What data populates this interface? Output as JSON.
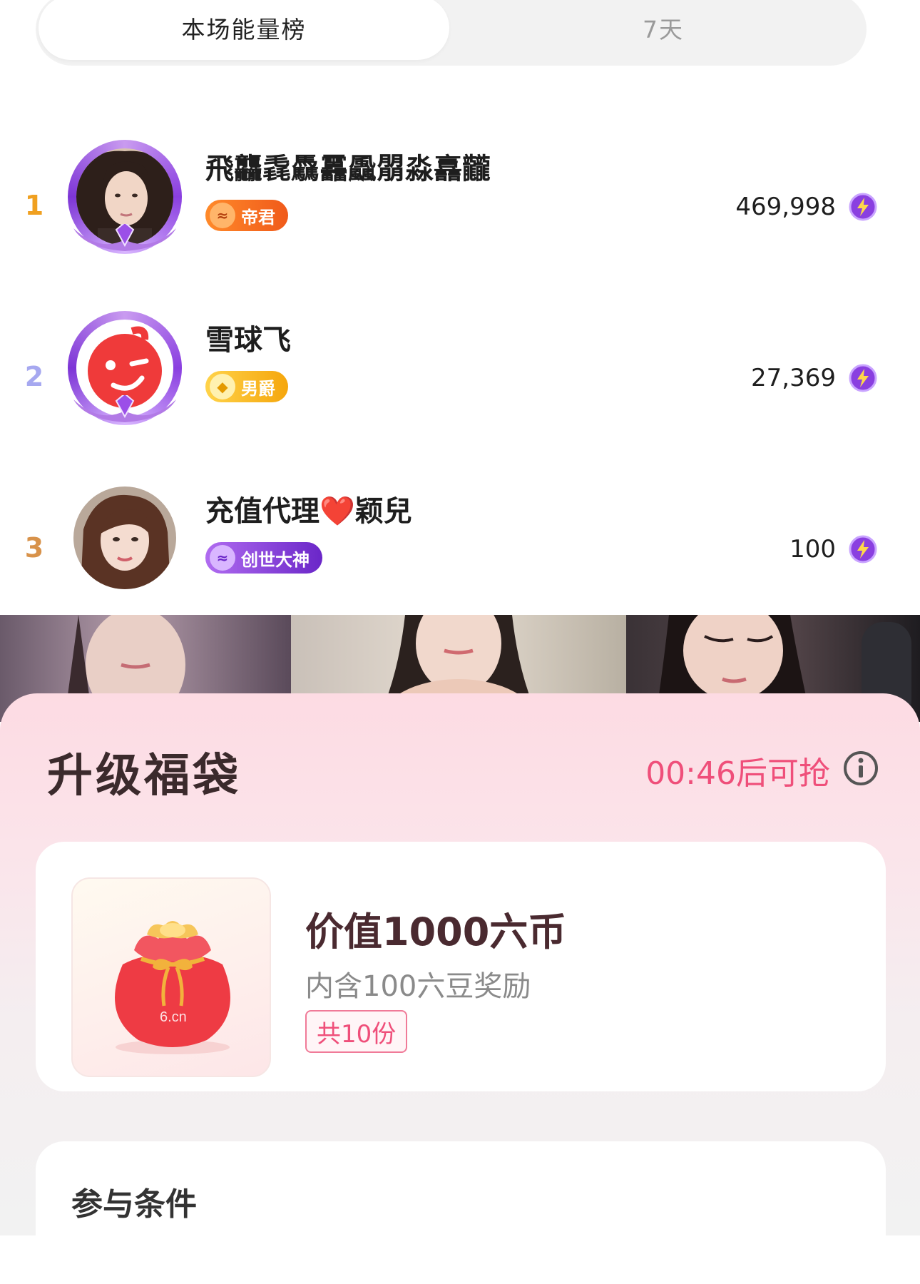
{
  "tabs": [
    {
      "label": "本场能量榜",
      "active": true
    },
    {
      "label": "7天",
      "active": false
    }
  ],
  "ranking": [
    {
      "rank": "1",
      "name": "飛龘毳驫靐飍朤淼譶龖",
      "badge": "帝君",
      "score": "469,998",
      "rank_color": "#f0a020",
      "badge_color": "#f06a1c"
    },
    {
      "rank": "2",
      "name": "雪球飞",
      "badge": "男爵",
      "score": "27,369",
      "rank_color": "#a6a8f0",
      "badge_color": "#f5b60c"
    },
    {
      "rank": "3",
      "name": "充值代理❤️颖兒",
      "badge": "创世大神",
      "score": "100",
      "rank_color": "#d8924a",
      "badge_color": "#8a3fe0"
    }
  ],
  "lucky_bag": {
    "title": "升级福袋",
    "countdown": "00:46后可抢",
    "prize_title": "价值1000六币",
    "prize_sub": "内含100六豆奖励",
    "prize_tag": "共10份",
    "bag_logo": "6.cn",
    "conditions_title": "参与条件"
  },
  "icons": {
    "energy": "lightning-icon",
    "info": "info-icon"
  },
  "colors": {
    "accent_pink": "#ef4f7a",
    "energy_purple": "#8a3fe0"
  }
}
